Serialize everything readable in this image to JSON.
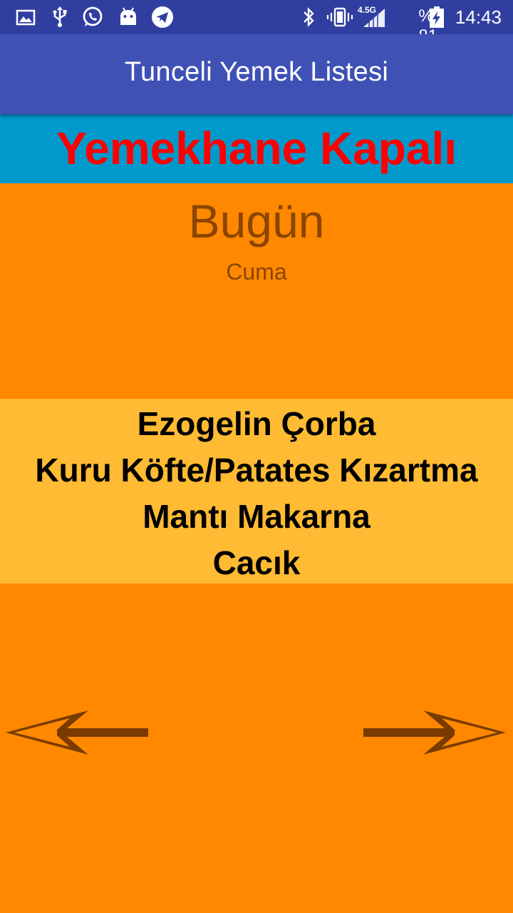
{
  "status_bar": {
    "network": "4.5G",
    "battery": "% 81",
    "time": "14:43",
    "left_icons": [
      "image-icon",
      "usb-icon",
      "whatsapp-icon",
      "android-icon",
      "telegram-icon"
    ],
    "right_icons": [
      "bluetooth-icon",
      "vibrate-icon",
      "signal-icon",
      "battery-charging-icon"
    ]
  },
  "app_bar": {
    "title": "Tunceli Yemek Listesi",
    "color": "#3F51B5"
  },
  "notice": {
    "text": "Yemekhane Kapalı",
    "background": "#0099CC",
    "color": "#FF0000"
  },
  "day": {
    "title": "Bugün",
    "name": "Cuma",
    "color": "#8B4500"
  },
  "menu": {
    "background": "#FFBB33",
    "items": [
      "Ezogelin Çorba",
      "Kuru Köfte/Patates Kızartma",
      "Mantı Makarna",
      "Cacık"
    ]
  },
  "navigation": {
    "prev_icon": "arrow-left-icon",
    "next_icon": "arrow-right-icon",
    "color": "#7A3B00"
  },
  "background": "#FF8800"
}
